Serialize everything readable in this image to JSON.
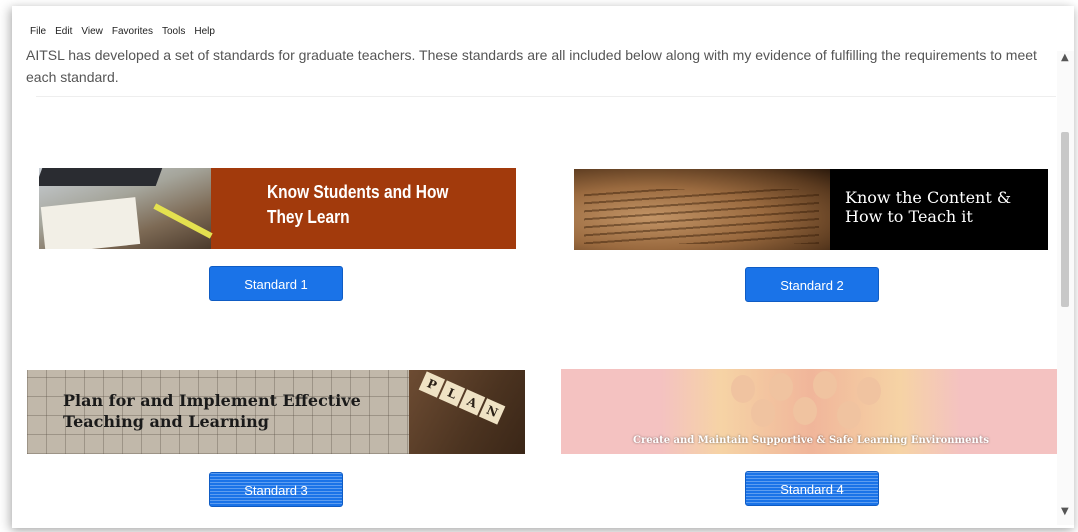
{
  "menu": [
    "File",
    "Edit",
    "View",
    "Favorites",
    "Tools",
    "Help"
  ],
  "intro": "AITSL has developed a set of standards for graduate teachers. These standards are all included below along with my evidence of fulfilling the requirements to meet each standard.",
  "standards": [
    {
      "banner_title": "Know Students and How They Learn",
      "button_label": "Standard 1",
      "banner_color": "#a23a0c"
    },
    {
      "banner_title": "Know the Content & How to Teach it",
      "button_label": "Standard 2",
      "banner_color": "#000000"
    },
    {
      "banner_title": "Plan for and Implement Effective Teaching and Learning",
      "button_label": "Standard 3",
      "banner_color": "#c1b8aa",
      "tile_letters": [
        "P",
        "L",
        "A",
        "N"
      ]
    },
    {
      "banner_title": "Create and Maintain Supportive & Safe Learning Environments",
      "button_label": "Standard 4",
      "banner_color": "#f4c2c1"
    }
  ],
  "colors": {
    "button": "#1a73e8",
    "text": "#555555"
  },
  "icons": {
    "scroll_up": "chevron-up-icon",
    "scroll_down": "chevron-down-icon"
  }
}
